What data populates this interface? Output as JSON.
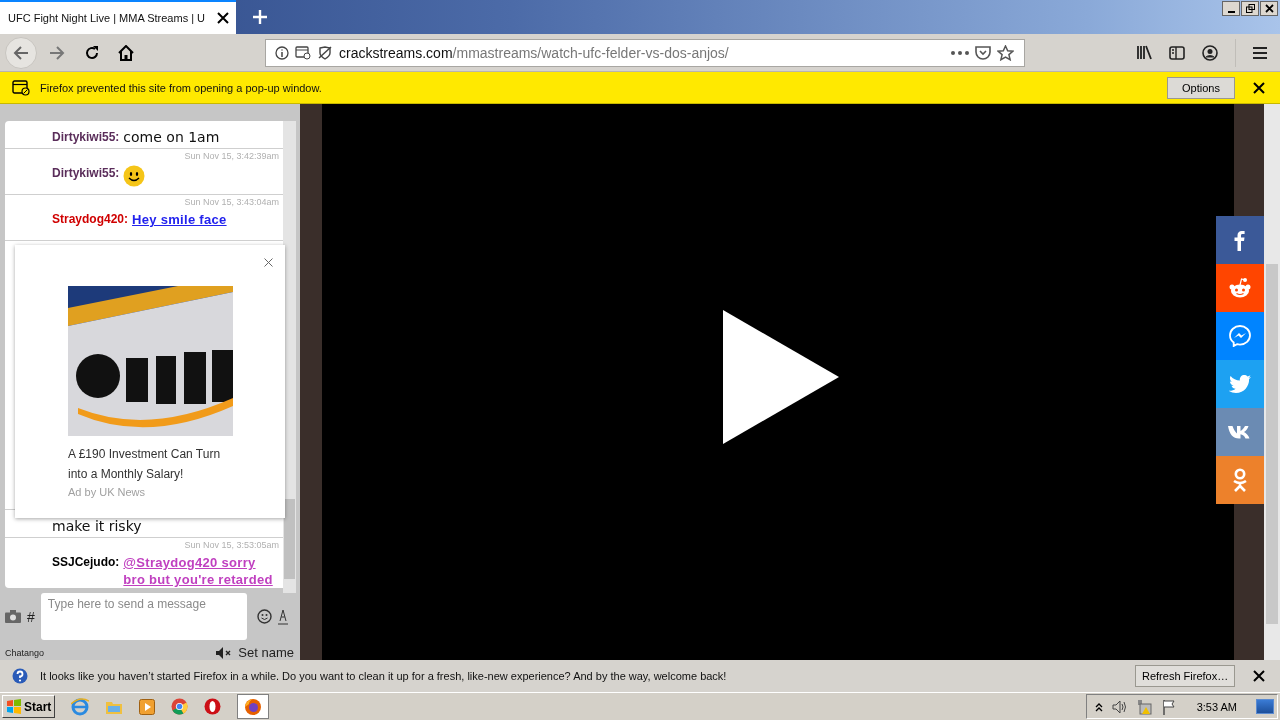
{
  "browser": {
    "tab_title": "UFC Fight Night Live | MMA Streams | U",
    "url_host": "crackstreams.com",
    "url_path": "/mmastreams/watch-ufc-felder-vs-dos-anjos/"
  },
  "popup_bar": {
    "message": "Firefox prevented this site from opening a pop-up window.",
    "button": "Options"
  },
  "chat": {
    "messages": [
      {
        "user": "Dirtykiwi55:",
        "color": "#5a2d5a",
        "kind": "plain",
        "text": "come on 1am"
      },
      {
        "time": "Sun Nov 15, 3:42:39am",
        "user": "Dirtykiwi55:",
        "color": "#5a2d5a",
        "kind": "emoji"
      },
      {
        "time": "Sun Nov 15, 3:43:04am",
        "user": "Straydog420:",
        "color": "#d00000",
        "kind": "link",
        "text": "Hey smile face",
        "visited": false
      },
      {
        "kind": "hidden"
      },
      {
        "kind": "plain",
        "text": "make it risky"
      },
      {
        "time": "Sun Nov 15, 3:53:05am",
        "user": "SSJCejudo:",
        "color": "#000000",
        "kind": "link",
        "text": "@Straydog420 sorry bro but you're retarded",
        "visited": true
      }
    ],
    "input_placeholder": "Type here to send a message",
    "hash": "#",
    "brand": "Chatango",
    "set_name": "Set name"
  },
  "ad": {
    "kind": "picture",
    "headline": "A £190 Investment Can Turn into a Monthly Salary!",
    "source": "Ad by UK News"
  },
  "share_buttons": [
    {
      "kind": "facebook",
      "color": "#3b5998"
    },
    {
      "kind": "reddit",
      "color": "#ff4500"
    },
    {
      "kind": "messenger",
      "color": "#0084ff"
    },
    {
      "kind": "twitter",
      "color": "#1da1f2"
    },
    {
      "kind": "vk",
      "color": "#6b8bb3"
    },
    {
      "kind": "odnoklassniki",
      "color": "#ed812b"
    }
  ],
  "refresh_bar": {
    "message": "It looks like you haven’t started Firefox in a while. Do you want to clean it up for a fresh, like-new experience? And by the way, welcome back!",
    "button": "Refresh Firefox…"
  },
  "taskbar": {
    "start": "Start",
    "clock": "3:53 AM"
  }
}
